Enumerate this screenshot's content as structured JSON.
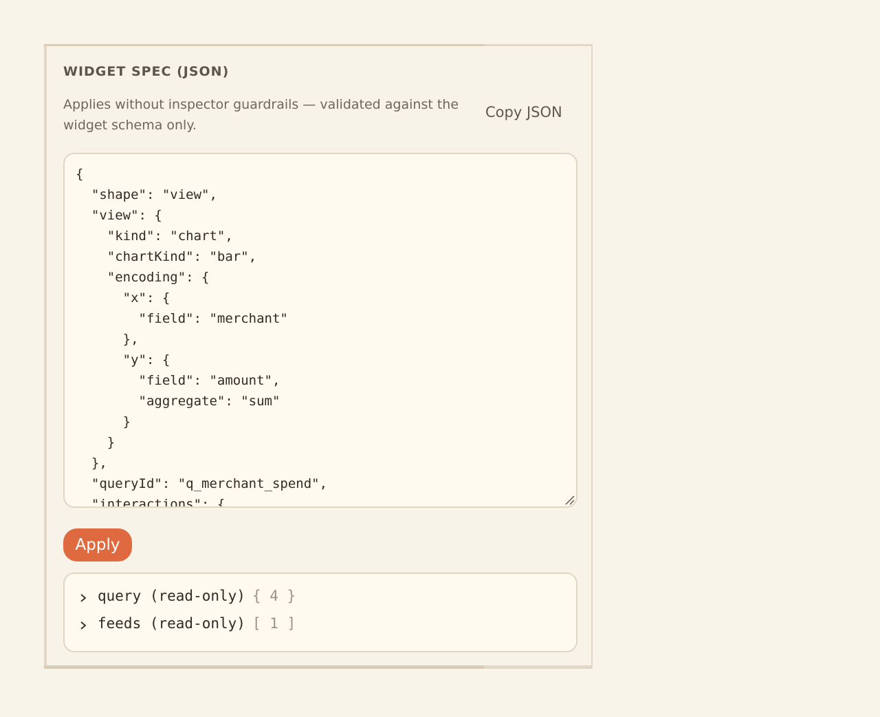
{
  "panel": {
    "title": "WIDGET SPEC (JSON)",
    "description": "Applies without inspector guardrails — validated against the widget schema only.",
    "copy_label": "Copy JSON",
    "apply_label": "Apply"
  },
  "editor": {
    "value": "{\n  \"shape\": \"view\",\n  \"view\": {\n    \"kind\": \"chart\",\n    \"chartKind\": \"bar\",\n    \"encoding\": {\n      \"x\": {\n        \"field\": \"merchant\"\n      },\n      \"y\": {\n        \"field\": \"amount\",\n        \"aggregate\": \"sum\"\n      }\n    }\n  },\n  \"queryId\": \"q_merchant_spend\",\n  \"interactions\": {"
  },
  "readonly": {
    "items": [
      {
        "label": "query (read-only)",
        "count": "{ 4 }"
      },
      {
        "label": "feeds (read-only)",
        "count": "[ 1 ]"
      }
    ]
  },
  "colors": {
    "accent": "#e06a40",
    "background": "#f9f4ea",
    "panel": "#f8f3e9",
    "border": "#e0d6c4"
  },
  "icons": {
    "row_toggle": "chevron-right-icon",
    "resize": "resize-grip-icon"
  }
}
